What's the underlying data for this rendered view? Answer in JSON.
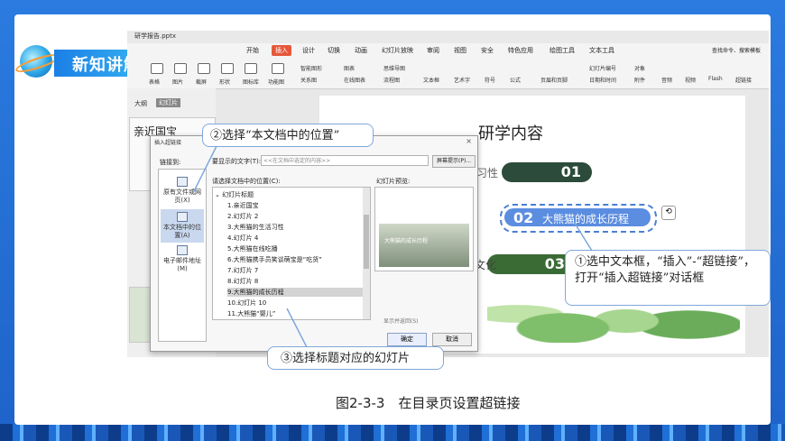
{
  "slide": {
    "title": "新知讲解",
    "caption": "图2-3-3　在目录页设置超链接"
  },
  "app": {
    "file_tab": "研学报告.pptx",
    "menus": [
      "开始",
      "插入",
      "设计",
      "切换",
      "动画",
      "幻灯片放映",
      "审阅",
      "视图",
      "安全",
      "特色应用",
      "绘图工具",
      "文本工具"
    ],
    "active_menu": "插入",
    "search": "查找命令、搜索模板",
    "ribbon": [
      "表格",
      "图片",
      "截屏",
      "形状",
      "图标库",
      "功能图",
      "智能图形",
      "关系图",
      "图表",
      "在线图表",
      "思维导图",
      "流程图",
      "文本框",
      "艺术字",
      "符号",
      "公式",
      "页眉和页脚",
      "幻灯片编号",
      "日期和时间",
      "对象",
      "附件",
      "音频",
      "视频",
      "Flash",
      "超链接"
    ],
    "left_pane": {
      "tab_outline": "大纲",
      "tab_slides": "幻灯片",
      "thumb_text": "亲近国宝"
    }
  },
  "slide_content": {
    "heading": "研学内容",
    "items": [
      {
        "num": "01",
        "label": "习性"
      },
      {
        "num": "02",
        "label": "大熊猫的成长历程"
      },
      {
        "num": "03",
        "label": "文化"
      }
    ]
  },
  "dialog": {
    "title": "插入超链接",
    "link_to": "链接到:",
    "link_targets": [
      "原有文件或网页(X)",
      "本文档中的位置(A)",
      "电子邮件地址(M)"
    ],
    "selected_target": "本文档中的位置(A)",
    "display_label": "要显示的文字(T):",
    "display_value": "<<在文档中选定的内容>>",
    "tip_button": "屏幕提示(P)...",
    "tree_label": "请选择文档中的位置(C):",
    "tree_root": "幻灯片标题",
    "slides": [
      "1.亲近国宝",
      "2.幻灯片 2",
      "3.大熊猫的生活习性",
      "4.幻灯片 4",
      "5.大熊猫在线吃播",
      "6.大熊猫携手员笑谈萌宝是“吃货”",
      "7.幻灯片 7",
      "8.幻灯片 8",
      "9.大熊猫的成长历程",
      "10.幻灯片 10",
      "11.大熊猫“婴儿”"
    ],
    "selected_slide": "9.大熊猫的成长历程",
    "preview_label": "幻灯片预览:",
    "preview_caption": "大熊猫的成长历程",
    "show_return": "显示并返回(S)",
    "ok": "确定",
    "cancel": "取消"
  },
  "callouts": {
    "step1": "①选中文本框，“插入”-“超链接”，打开“插入超链接”对话框",
    "step2": "②选择“本文档中的位置”",
    "step3": "③选择标题对应的幻灯片"
  },
  "colors": {
    "accent": "#e6573a",
    "frame": "#1f6fd6",
    "pill_blue": "#5b8de0",
    "pill_green": "#3b6b34"
  }
}
